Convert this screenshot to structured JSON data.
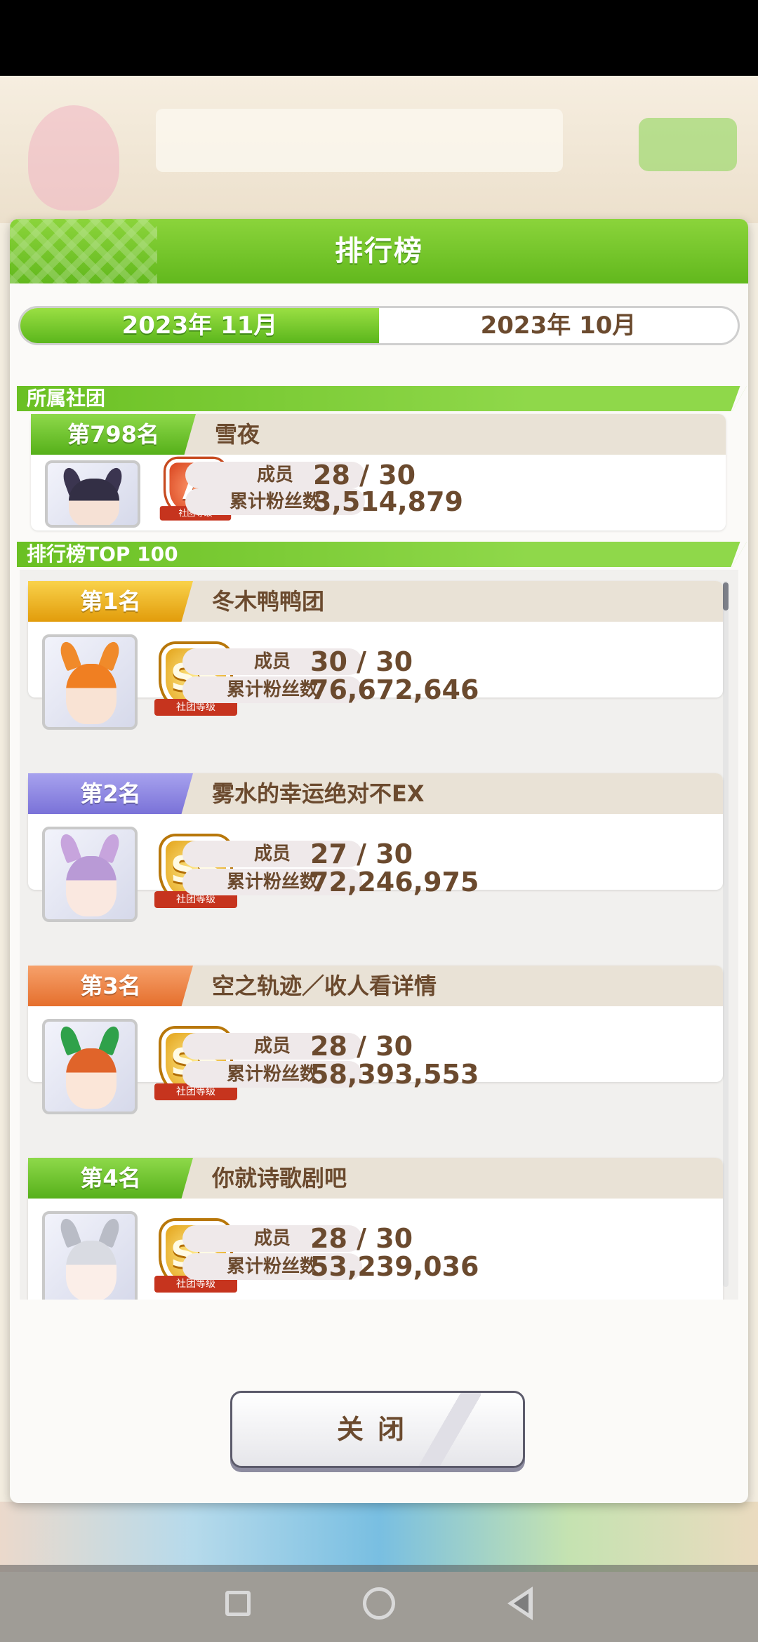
{
  "modal": {
    "title": "排行榜",
    "tabs": [
      {
        "label": "2023年 11月",
        "active": true
      },
      {
        "label": "2023年 10月",
        "active": false
      }
    ],
    "close_label": "关闭"
  },
  "my_club": {
    "section_label": "所属社团",
    "rank": "第798名",
    "name": "雪夜",
    "badge": "A",
    "badge_caption": "社团等级",
    "members_label": "成员",
    "members": "28 / 30",
    "fans_label": "累计粉丝数",
    "fans": "3,514,879"
  },
  "ranking": {
    "section_label": "排行榜TOP 100",
    "entries": [
      {
        "rank": "第1名",
        "name": "冬木鸭鸭团",
        "badge": "SS",
        "badge_caption": "社团等级",
        "members_label": "成员",
        "members": "30 / 30",
        "fans_label": "累计粉丝数",
        "fans": "76,672,646",
        "rank_color": "gold"
      },
      {
        "rank": "第2名",
        "name": "雾水的幸运绝对不EX",
        "badge": "SS",
        "badge_caption": "社团等级",
        "members_label": "成员",
        "members": "27 / 30",
        "fans_label": "累计粉丝数",
        "fans": "72,246,975",
        "rank_color": "purple"
      },
      {
        "rank": "第3名",
        "name": "空之轨迹／收人看详情",
        "badge": "SS",
        "badge_caption": "社团等级",
        "members_label": "成员",
        "members": "28 / 30",
        "fans_label": "累计粉丝数",
        "fans": "58,393,553",
        "rank_color": "orange"
      },
      {
        "rank": "第4名",
        "name": "你就诗歌剧吧",
        "badge": "SS",
        "badge_caption": "社团等级",
        "members_label": "成员",
        "members": "28 / 30",
        "fans_label": "累计粉丝数",
        "fans": "53,239,036",
        "rank_color": "green"
      }
    ]
  },
  "colors": {
    "accent_green": "#62b81d",
    "text_brown": "#6b4a2e"
  }
}
